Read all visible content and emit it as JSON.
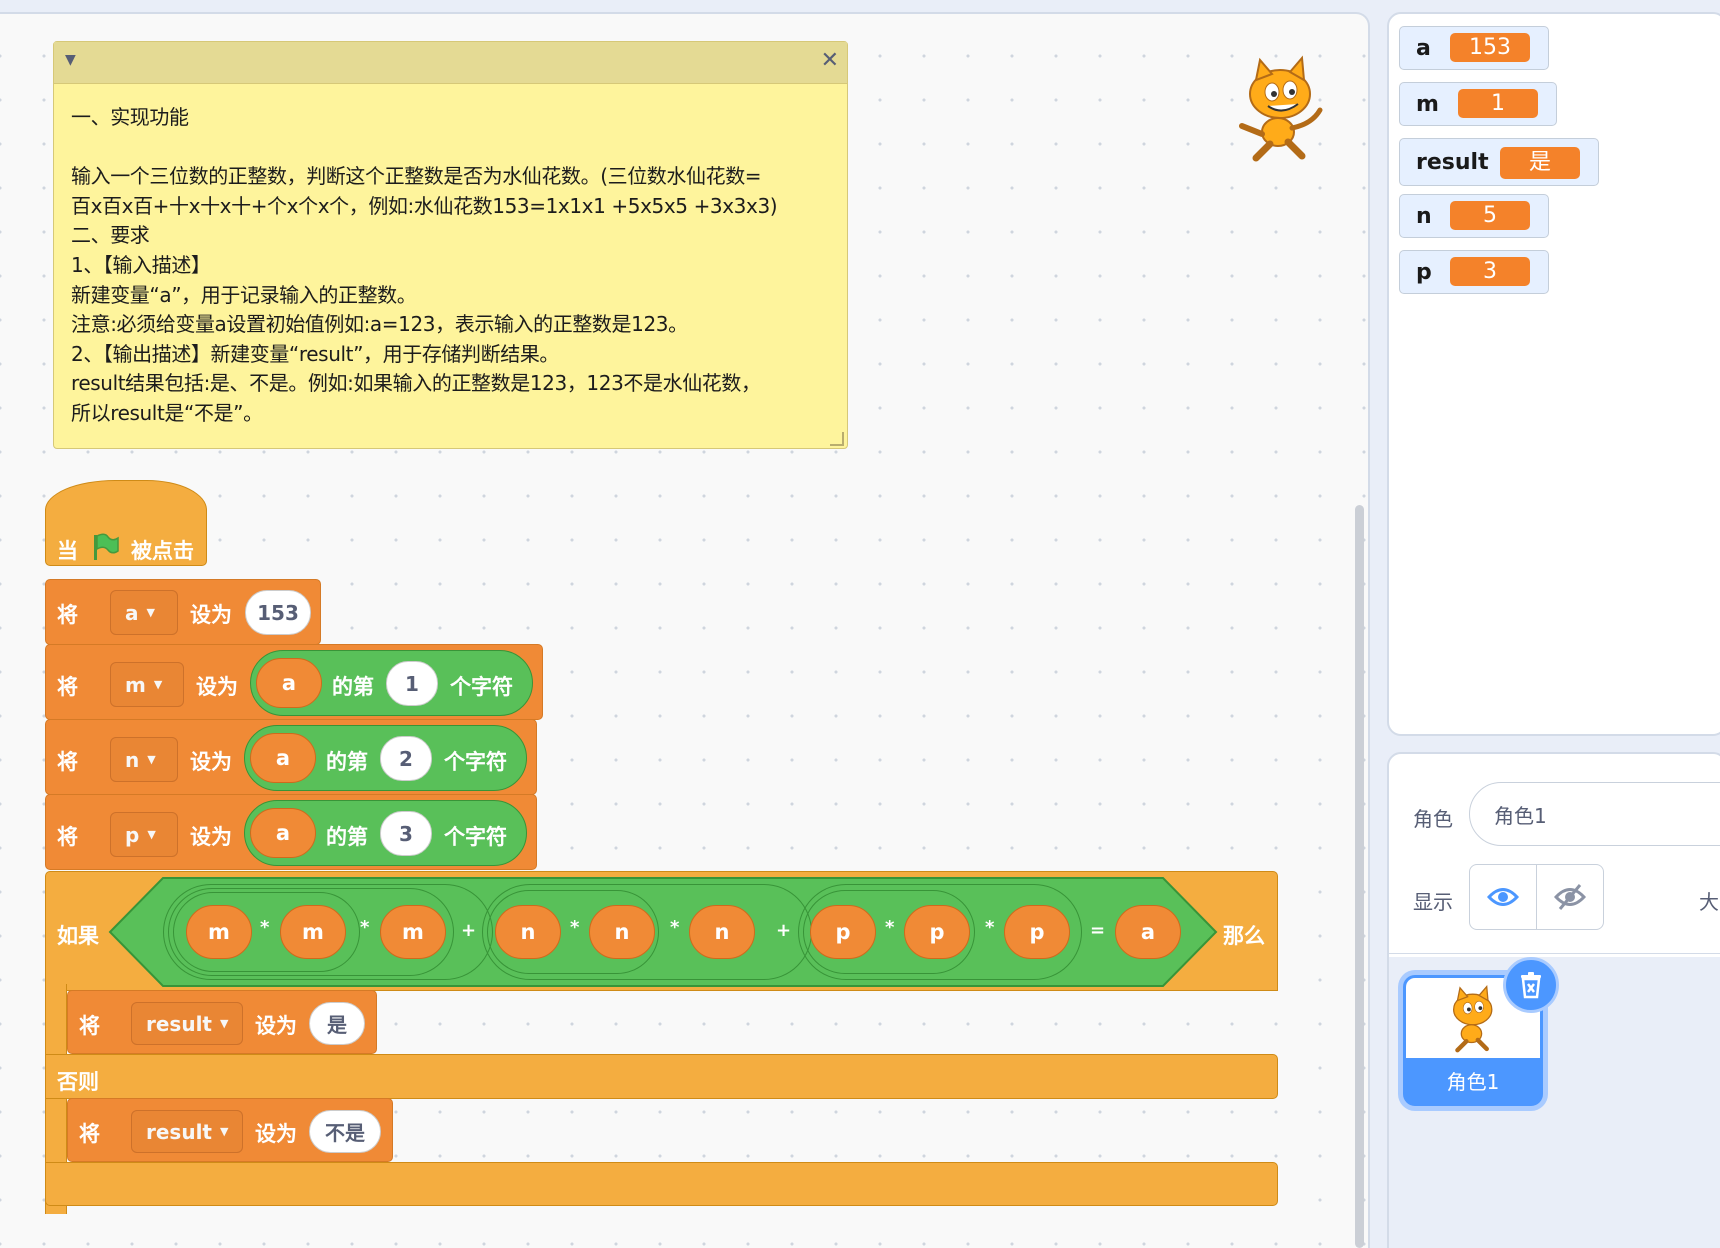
{
  "comment": {
    "lines": [
      "一、实现功能",
      "",
      "输入一个三位数的正整数，判断这个正整数是否为水仙花数。(三位数水仙花数=",
      "百x百x百+十x十x十+个x个x个，例如:水仙花数153=1x1x1 +5x5x5 +3x3x3)",
      "二、要求",
      "1、【输入描述】",
      "新建变量“a”，用于记录输入的正整数。",
      "注意:必须给变量a设置初始值例如:a=123，表示输入的正整数是123。",
      "2、【输出描述】新建变量“result”，用于存储判断结果。",
      "result结果包括:是、不是。例如:如果输入的正整数是123，123不是水仙花数，",
      "所以result是“不是”。"
    ],
    "collapse_icon": "caret-down-icon",
    "close_icon": "close-icon"
  },
  "script": {
    "hat": {
      "when": "当",
      "clicked": "被点击",
      "icon": "green-flag-icon"
    },
    "set_word": "将",
    "to_word": "设为",
    "set_a": {
      "var": "a",
      "value": "153"
    },
    "set_m": {
      "var": "m",
      "string": "a",
      "of_word": "的第",
      "index": "1",
      "char_word": "个字符"
    },
    "set_n": {
      "var": "n",
      "string": "a",
      "of_word": "的第",
      "index": "2",
      "char_word": "个字符"
    },
    "set_p": {
      "var": "p",
      "string": "a",
      "of_word": "的第",
      "index": "3",
      "char_word": "个字符"
    },
    "if_block": {
      "if_word": "如果",
      "then_word": "那么",
      "else_word": "否则",
      "terms": [
        "m",
        "m",
        "m",
        "n",
        "n",
        "n",
        "p",
        "p",
        "p"
      ],
      "times": "*",
      "plus": "+",
      "equals": "=",
      "rhs": "a"
    },
    "set_result_yes": {
      "var": "result",
      "value": "是"
    },
    "set_result_no": {
      "var": "result",
      "value": "不是"
    }
  },
  "monitors": [
    {
      "name": "a",
      "value": "153"
    },
    {
      "name": "m",
      "value": "1"
    },
    {
      "name": "result",
      "value": "是"
    },
    {
      "name": "n",
      "value": "5"
    },
    {
      "name": "p",
      "value": "3"
    }
  ],
  "sprite_info": {
    "sprite_label": "角色",
    "sprite_name": "角色1",
    "show_label": "显示",
    "size_label_partial": "大",
    "show_icon": "eye-icon",
    "hide_icon": "eye-slash-icon"
  },
  "sprite_list": {
    "thumbnail_name": "角色1",
    "delete_icon": "trash-icon"
  },
  "colors": {
    "events": "#f4ad40",
    "variables": "#f08a36",
    "operators": "#59c059",
    "comment": "#fef49c",
    "accent": "#4c97ff"
  }
}
